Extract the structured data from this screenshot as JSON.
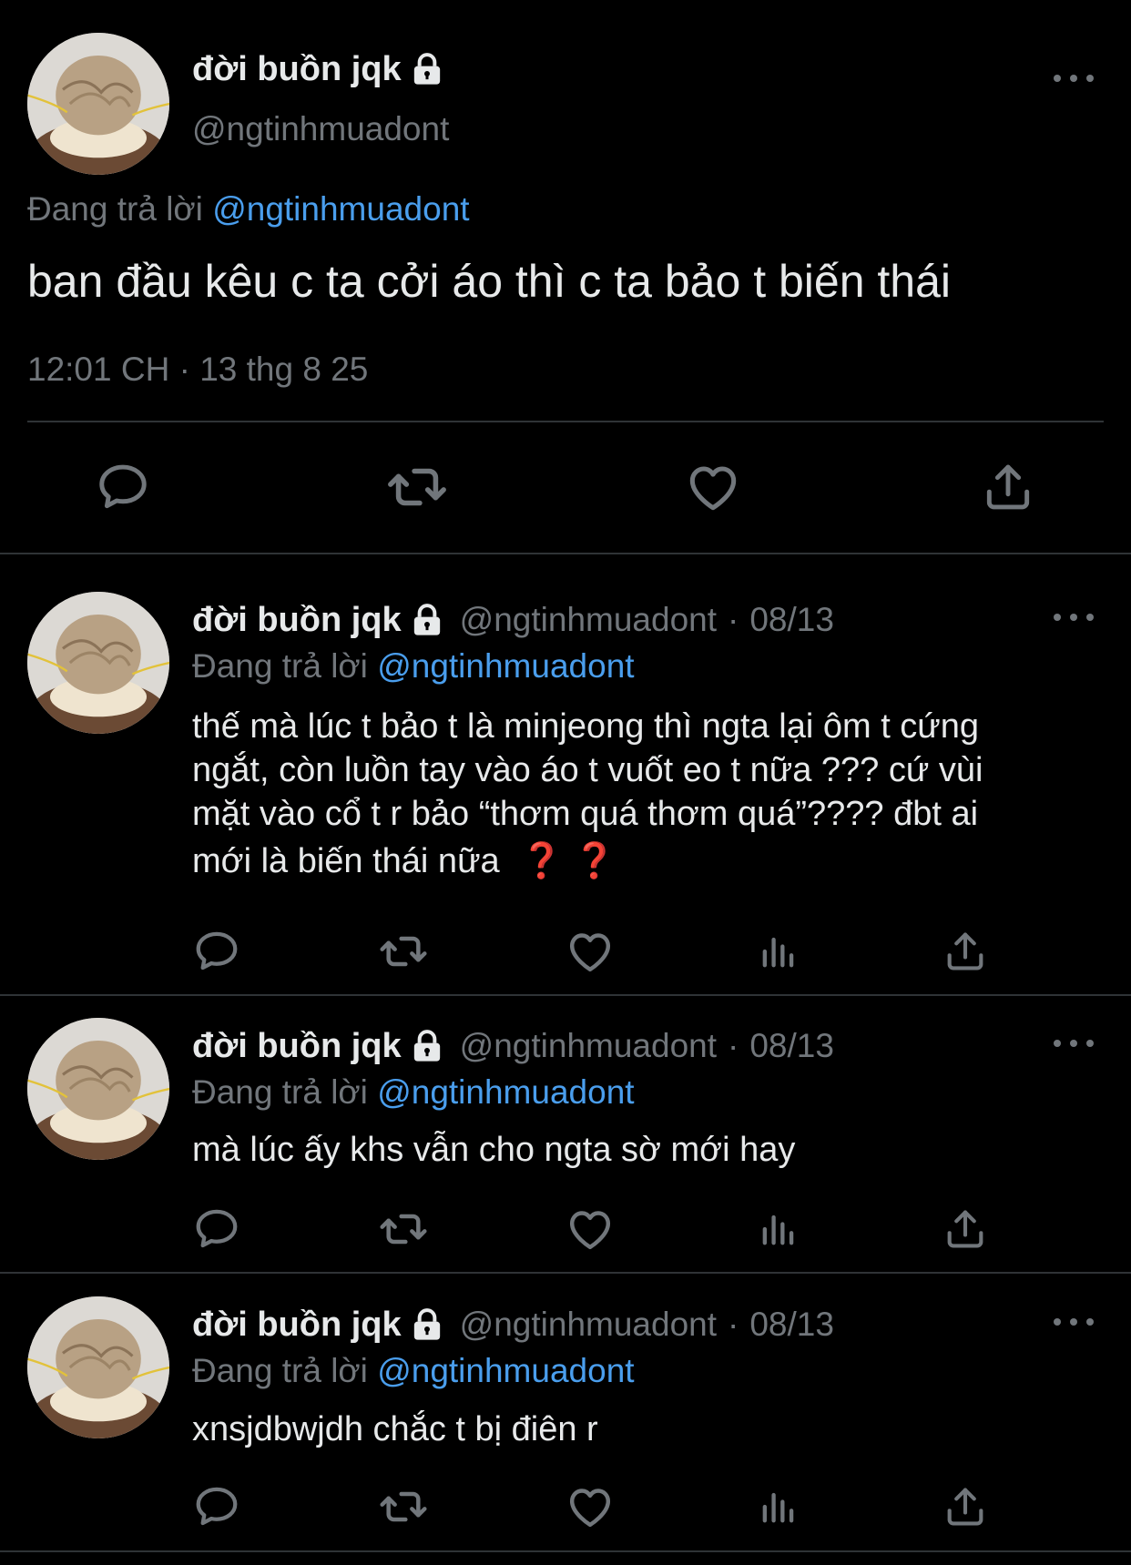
{
  "main_tweet": {
    "display_name": "đời buồn jqk",
    "handle": "@ngtinhmuadont",
    "replying_prefix": "Đang trả lời",
    "replying_to": "@ngtinhmuadont",
    "text": "ban đầu kêu c ta cởi áo thì c ta bảo t biến thái",
    "timestamp": "12:01 CH · 13 thg 8 25"
  },
  "replies": [
    {
      "display_name": "đời buồn jqk",
      "handle": "@ngtinhmuadont",
      "separator": "·",
      "date": "08/13",
      "replying_prefix": "Đang trả lời",
      "replying_to": "@ngtinhmuadont",
      "lines": [
        "thế mà lúc t bảo t là minjeong thì ngta lại ôm t cứng",
        "ngắt, còn luồn tay vào áo t vuốt eo t nữa ??? cứ vùi",
        "mặt vào cổ t r bảo “thơm quá thơm quá”???? đbt ai",
        "mới là biến thái nữa"
      ],
      "emoji": "❓ ❓"
    },
    {
      "display_name": "đời buồn jqk",
      "handle": "@ngtinhmuadont",
      "separator": "·",
      "date": "08/13",
      "replying_prefix": "Đang trả lời",
      "replying_to": "@ngtinhmuadont",
      "lines": [
        "mà lúc ấy khs vẫn cho ngta sờ mới hay"
      ]
    },
    {
      "display_name": "đời buồn jqk",
      "handle": "@ngtinhmuadont",
      "separator": "·",
      "date": "08/13",
      "replying_prefix": "Đang trả lời",
      "replying_to": "@ngtinhmuadont",
      "lines": [
        "xnsjdbwjdh chắc t bị điên r"
      ]
    }
  ],
  "icons": {
    "reply": "reply-icon",
    "retweet": "retweet-icon",
    "like": "heart-icon",
    "views": "views-icon",
    "share": "share-icon",
    "more": "more-icon",
    "lock": "lock-icon"
  },
  "colors": {
    "background": "#000000",
    "text": "#e7e9ea",
    "muted": "#71767b",
    "link": "#4a9eed",
    "divider": "#2f3336"
  }
}
